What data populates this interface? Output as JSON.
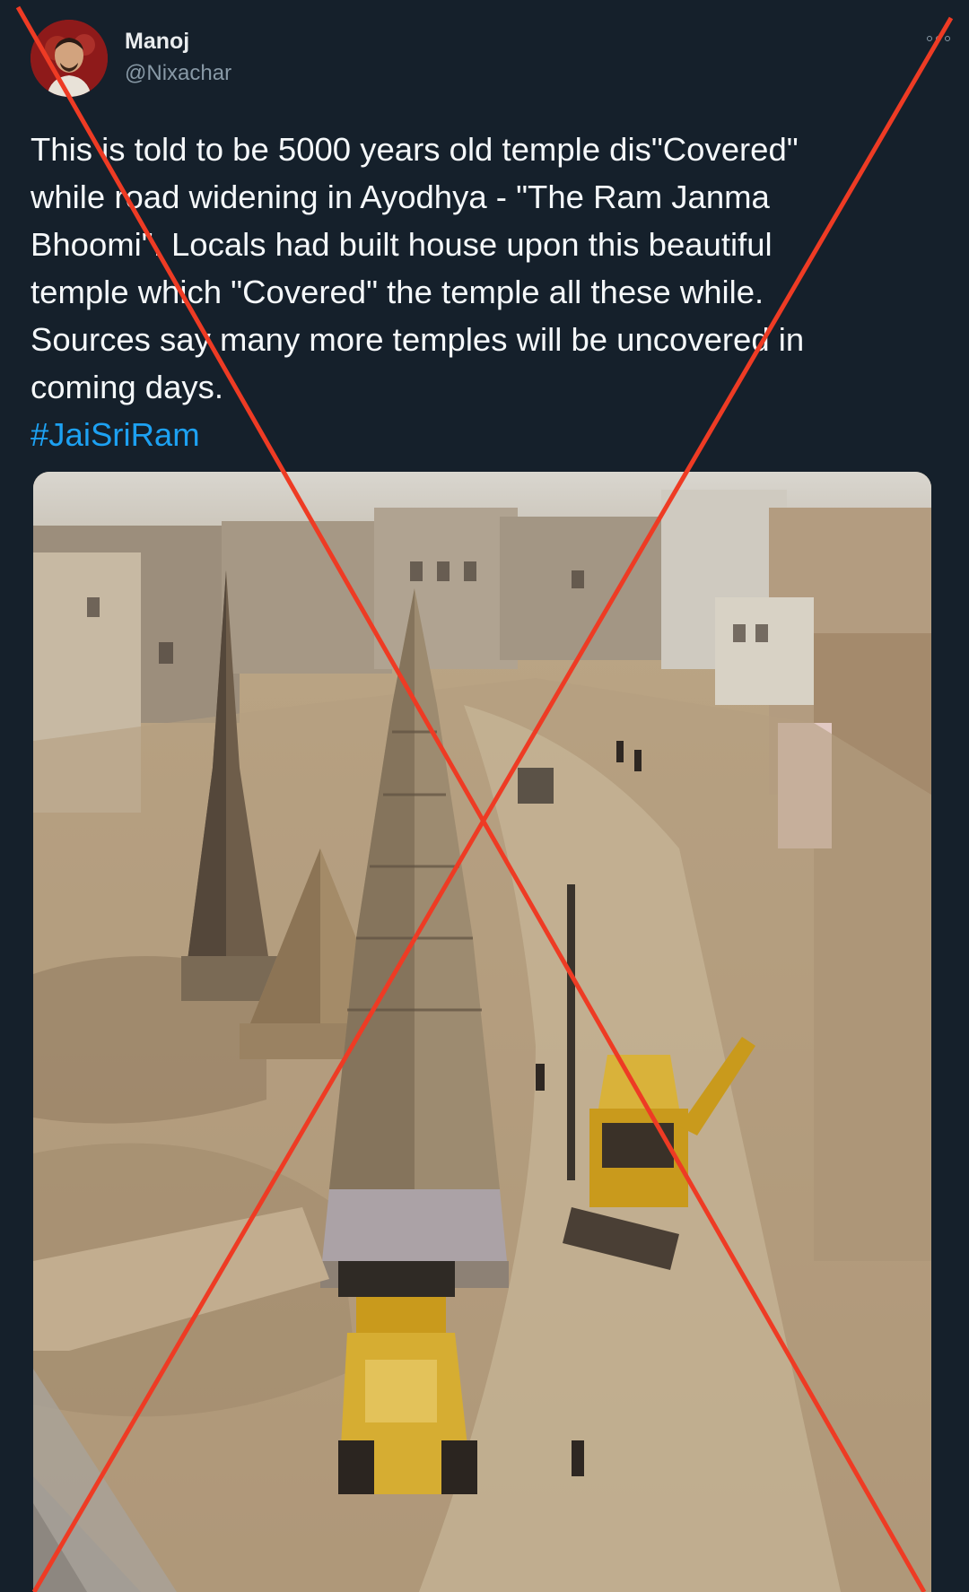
{
  "tweet": {
    "author_name": "Manoj",
    "author_handle": "@Nixachar",
    "text": "This is told to be 5000 years old temple dis\"Covered\"\nwhile road widening in Ayodhya - \"The Ram Janma\nBhoomi\". Locals had built house upon this beautiful\ntemple which \"Covered\" the temple all these while.\nSources say many more temples will be uncovered in\ncoming days.",
    "hashtag": "#JaiSriRam"
  },
  "icons": {
    "more": "more-options-icon",
    "overlay": "red-cross-mark"
  },
  "colors": {
    "background": "#15202b",
    "text": "#f5f8fa",
    "secondary": "#8899a6",
    "link": "#1da1f2",
    "cross": "#ee3b24"
  }
}
